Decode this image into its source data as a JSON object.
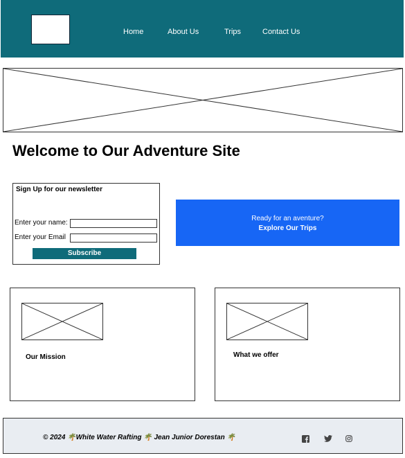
{
  "header": {
    "nav": {
      "home": "Home",
      "about": "About Us",
      "trips": "Trips",
      "contact": "Contact Us"
    }
  },
  "main": {
    "title": "Welcome to Our Adventure Site"
  },
  "newsletter": {
    "title": "Sign Up for our newsletter",
    "name_label": "Enter your name:",
    "name_value": "",
    "email_label": "Enter your Email",
    "email_value": "",
    "subscribe_label": "Subscribe"
  },
  "cta": {
    "line1": "Ready for an aventure?",
    "line2": "Explore Our Trips"
  },
  "cards": {
    "mission": "Our Mission",
    "offer": "What we offer"
  },
  "footer": {
    "text": "© 2024 🌴White Water Rafting  🌴 Jean Junior Dorestan  🌴",
    "icons": [
      "facebook-icon",
      "twitter-icon",
      "instagram-icon"
    ]
  },
  "colors": {
    "header_bg": "#0f6b7a",
    "cta_bg": "#1766f5",
    "footer_bg": "#e9edf2"
  }
}
